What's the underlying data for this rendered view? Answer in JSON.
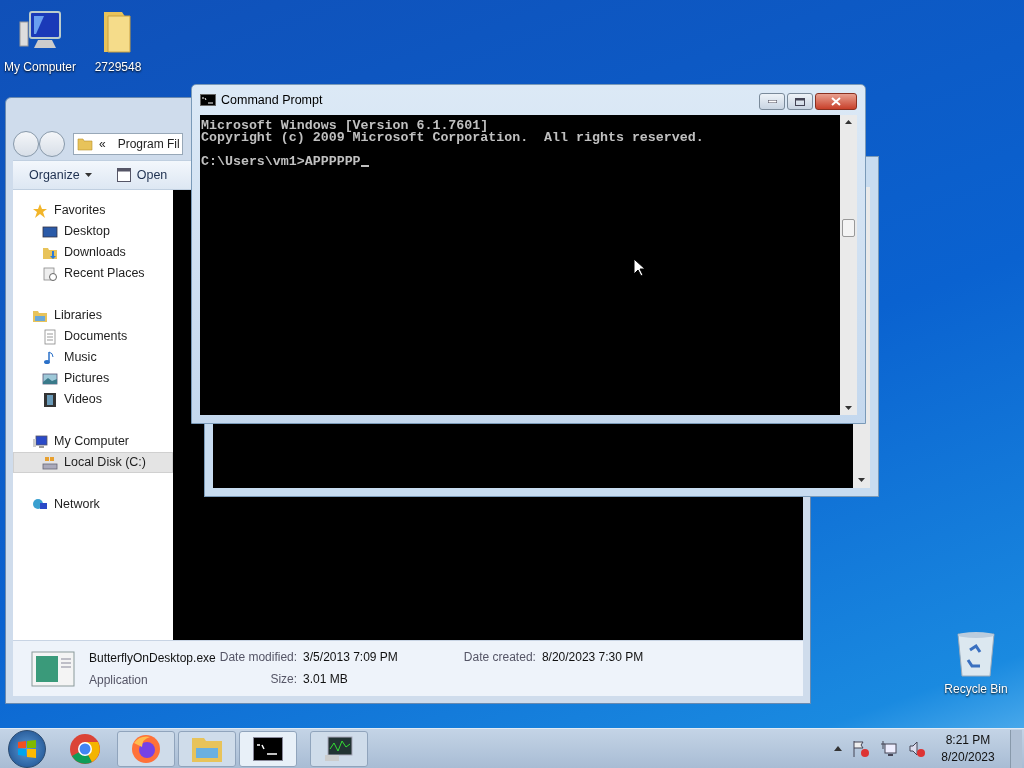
{
  "desktop_icons": [
    {
      "label": "My Computer",
      "kind": "computer"
    },
    {
      "label": "2729548",
      "kind": "folder"
    },
    {
      "label": "Recycle Bin",
      "kind": "recycle"
    }
  ],
  "explorer": {
    "address": {
      "prefix": "«",
      "text": "Program Fil"
    },
    "toolbar": [
      {
        "label": "Organize",
        "kind": "menu"
      },
      {
        "label": "Open",
        "kind": "open"
      }
    ],
    "sidebar": [
      {
        "label": "Favorites",
        "kind": "star",
        "selected": false,
        "children": [
          {
            "label": "Desktop",
            "kind": "desktop",
            "selected": false
          },
          {
            "label": "Downloads",
            "kind": "downloads",
            "selected": false
          },
          {
            "label": "Recent Places",
            "kind": "recent",
            "selected": false
          }
        ]
      },
      {
        "label": "Libraries",
        "kind": "libraries",
        "selected": false,
        "children": [
          {
            "label": "Documents",
            "kind": "documents",
            "selected": false
          },
          {
            "label": "Music",
            "kind": "music",
            "selected": false
          },
          {
            "label": "Pictures",
            "kind": "pictures",
            "selected": false
          },
          {
            "label": "Videos",
            "kind": "videos",
            "selected": false
          }
        ]
      },
      {
        "label": "My Computer",
        "kind": "computer",
        "selected": false,
        "children": [
          {
            "label": "Local Disk (C:)",
            "kind": "disk",
            "selected": true
          }
        ]
      },
      {
        "label": "Network",
        "kind": "network",
        "selected": false
      }
    ],
    "details": {
      "name": "ButterflyOnDesktop.exe",
      "type": "Application",
      "fields": [
        {
          "label": "Date modified:",
          "value": "3/5/2013 7:09 PM"
        },
        {
          "label": "Date created:",
          "value": "8/20/2023 7:30 PM"
        },
        {
          "label": "Size:",
          "value": "3.01 MB"
        }
      ]
    }
  },
  "command_prompt": {
    "title": "Command Prompt",
    "output_lines": [
      "Microsoft Windows [Version 6.1.7601]",
      "Copyright (c) 2009 Microsoft Corporation.  All rights reserved."
    ],
    "prompt": "C:\\Users\\vm1>APPPPPP"
  },
  "taskbar": {
    "items": [
      {
        "kind": "chrome",
        "running": false,
        "selected": false
      },
      {
        "kind": "firefox",
        "running": true,
        "selected": false
      },
      {
        "kind": "explorer",
        "running": true,
        "selected": false
      },
      {
        "kind": "cmd",
        "running": true,
        "selected": true
      },
      {
        "kind": "monitor",
        "running": true,
        "selected": false
      }
    ],
    "time": "8:21 PM",
    "date": "8/20/2023"
  }
}
